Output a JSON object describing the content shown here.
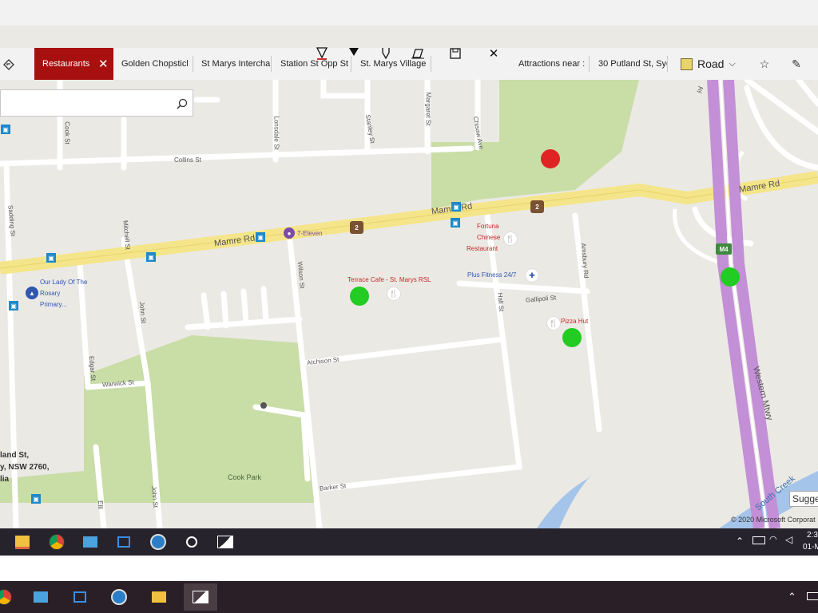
{
  "top": {
    "minimize_glyph": "—"
  },
  "tabs": [
    {
      "label": "Restaurants",
      "active": true
    },
    {
      "label": "Golden Chopsticl"
    },
    {
      "label": "St Marys Intercha"
    },
    {
      "label": "Station St Opp St"
    },
    {
      "label": "St. Marys Village"
    },
    {
      "label": "Attractions near :"
    },
    {
      "label": "30 Putland St, Syc"
    }
  ],
  "map_style": {
    "label": "Road"
  },
  "map": {
    "streets": [
      "Cook St",
      "Collins St",
      "Lonsdale St",
      "Stanley St",
      "Margaret St",
      "Chisaw Ave",
      "Mamre Rd",
      "Mamre Rd",
      "Mamre Rd",
      "Sadding St",
      "Mitchell St",
      "Wilson St",
      "John St",
      "Edgar St",
      "Warwick St",
      "Atchison St",
      "Hall St",
      "Gallipoli St",
      "Amsbury Rd",
      "Western Mtwy",
      "Barker St",
      "John St",
      "Elli",
      "South Creek",
      "Ay"
    ],
    "pois": [
      "7-Eleven",
      "Fortuna",
      "Chinese",
      "Restaurant",
      "Terrace Cafe - St. Marys RSL",
      "Plus Fitness 24/7",
      "Pizza Hut",
      "Our Lady Of The",
      "Rosary",
      "Primary...",
      "Cook Park"
    ],
    "address_lines": [
      "land St,",
      "y, NSW 2760,",
      "lia"
    ],
    "route_shields": [
      "2",
      "2",
      "M4"
    ],
    "suggest": "Sugge",
    "copyright": "© 2020 Microsoft Corporat"
  },
  "markers": [
    {
      "color": "#e02424"
    },
    {
      "color": "#22cc22"
    },
    {
      "color": "#22cc22"
    },
    {
      "color": "#22cc22"
    }
  ],
  "clock": {
    "time": "2:3",
    "date": "01-M"
  },
  "colors": {
    "accent": "#a80f0f",
    "park": "#c9dda7",
    "highway": "#f4e58a",
    "motorway": "#c38fd6",
    "water": "#a5c4ea"
  }
}
